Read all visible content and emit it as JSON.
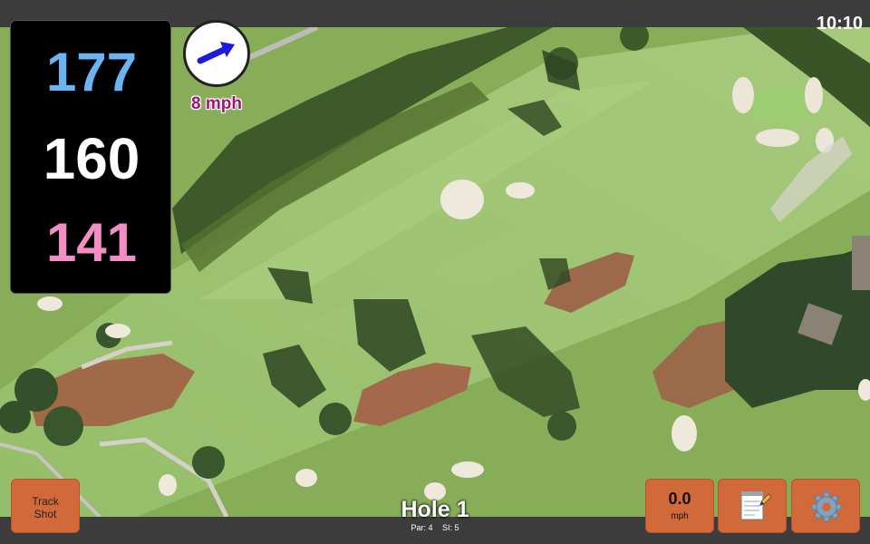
{
  "status_bar": {
    "time": "10:10"
  },
  "distances": {
    "back": "177",
    "middle": "160",
    "front": "141",
    "colors": {
      "back": "#6ab4f2",
      "middle": "#ffffff",
      "front": "#f28ec4"
    }
  },
  "wind": {
    "speed": "8 mph",
    "direction_icon": "arrow-east-icon",
    "text_color": "#a4127d"
  },
  "hole": {
    "title": "Hole 1",
    "par": "Par: 4",
    "stroke_index": "SI: 5"
  },
  "buttons": {
    "track_shot": {
      "line1": "Track",
      "line2": "Shot"
    },
    "speed": {
      "value": "0.0",
      "unit": "mph"
    },
    "notes": {
      "icon": "notepad-icon"
    },
    "settings": {
      "icon": "gear-icon"
    },
    "accent": "#d2693a"
  }
}
